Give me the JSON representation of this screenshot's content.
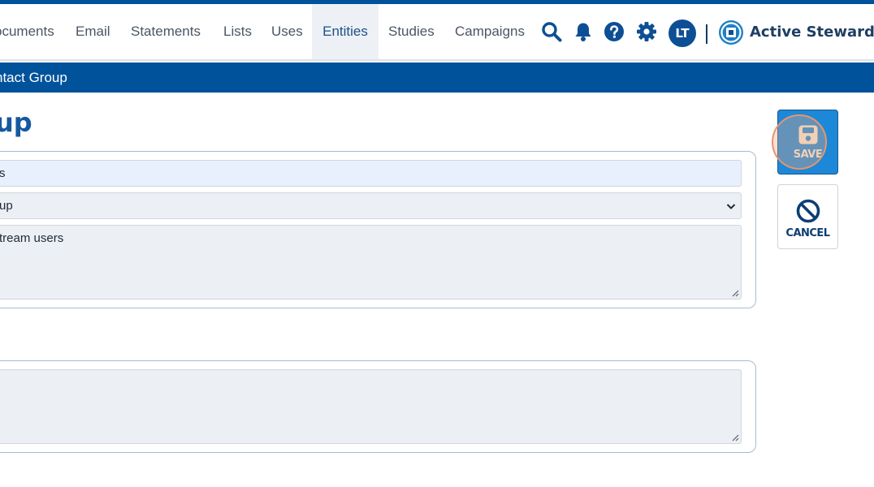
{
  "nav": {
    "items": [
      {
        "label": "ocuments",
        "active": false
      },
      {
        "label": "Email",
        "active": false
      },
      {
        "label": "Statements",
        "active": false
      },
      {
        "label": "Lists",
        "active": false
      },
      {
        "label": "Uses",
        "active": false
      },
      {
        "label": "Entities",
        "active": true
      },
      {
        "label": "Studies",
        "active": false
      },
      {
        "label": "Campaigns",
        "active": false
      }
    ],
    "icons": [
      "search-icon",
      "bell-icon",
      "help-icon",
      "gear-icon"
    ],
    "avatar_initials": "LT",
    "brand": "Active Steward"
  },
  "subbar": {
    "title": "ntact Group"
  },
  "page": {
    "title": "up"
  },
  "form": {
    "name_value": "s",
    "type_value": "up",
    "description_value": "tream users",
    "notes_value": ""
  },
  "actions": {
    "save_label": "SAVE",
    "cancel_label": "CANCEL"
  },
  "colors": {
    "brand_blue": "#00529b",
    "save_blue": "#1e88d8",
    "title_blue": "#1559a0",
    "click_highlight": "#e8956b"
  }
}
